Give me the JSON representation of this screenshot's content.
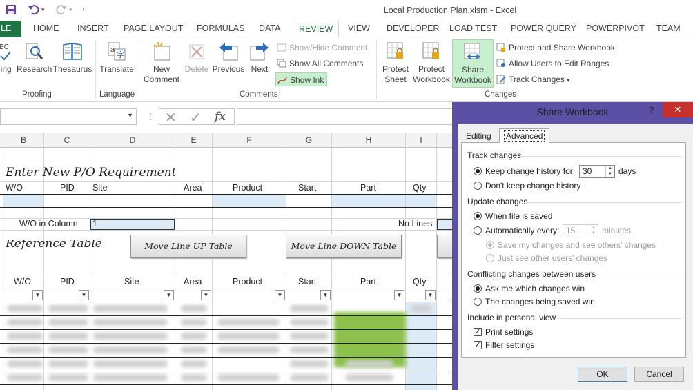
{
  "window": {
    "title": "Local Production Plan.xlsm - Excel"
  },
  "tabs": [
    "FILE",
    "HOME",
    "INSERT",
    "PAGE LAYOUT",
    "FORMULAS",
    "DATA",
    "REVIEW",
    "VIEW",
    "DEVELOPER",
    "LOAD TEST",
    "POWER QUERY",
    "POWERPIVOT",
    "TEAM"
  ],
  "active_tab": "REVIEW",
  "ribbon": {
    "proofing": {
      "spelling": "ling",
      "research": "Research",
      "thesaurus": "Thesaurus",
      "group": "Proofing"
    },
    "language": {
      "translate": "Translate",
      "group": "Language"
    },
    "comments": {
      "new_comment_1": "New",
      "new_comment_2": "Comment",
      "delete": "Delete",
      "previous": "Previous",
      "next": "Next",
      "show_hide": "Show/Hide Comment",
      "show_all": "Show All Comments",
      "show_ink": "Show Ink",
      "group": "Comments"
    },
    "changes": {
      "protect_sheet_1": "Protect",
      "protect_sheet_2": "Sheet",
      "protect_wb_1": "Protect",
      "protect_wb_2": "Workbook",
      "share_wb_1": "Share",
      "share_wb_2": "Workbook",
      "protect_share": "Protect and Share Workbook",
      "allow_users": "Allow Users to Edit Ranges",
      "track_changes": "Track Changes",
      "group": "Changes"
    }
  },
  "formula_bar": {
    "fx": "fx"
  },
  "grid": {
    "columns": [
      "B",
      "C",
      "D",
      "E",
      "F",
      "G",
      "H",
      "I"
    ],
    "heading_new": "Enter New P/O Requirement",
    "heading_ref": "Reference Table",
    "headers": [
      "W/O",
      "PID",
      "Site",
      "Area",
      "Product",
      "Start",
      "Part",
      "Qty"
    ],
    "wo_in_column_label": "W/O in Column",
    "wo_in_column_value": "1",
    "no_lines": "No Lines",
    "move_up": "Move Line UP Table",
    "move_down": "Move Line DOWN Table"
  },
  "dialog": {
    "title": "Share Workbook",
    "help": "?",
    "close": "✕",
    "tabs": [
      "Editing",
      "Advanced"
    ],
    "active_tab": "Advanced",
    "track_changes": {
      "label": "Track changes",
      "keep_history": "Keep change history for:",
      "days_value": "30",
      "days_unit": "days",
      "dont_keep": "Don't keep change history",
      "selected": "keep"
    },
    "update_changes": {
      "label": "Update changes",
      "when_saved": "When file is saved",
      "automatically": "Automatically every:",
      "minutes_value": "15",
      "minutes_unit": "minutes",
      "save_my_changes": "Save my changes and see others' changes",
      "just_see": "Just see other users' changes",
      "selected": "when_saved"
    },
    "conflicting": {
      "label": "Conflicting changes between users",
      "ask_me": "Ask me which changes win",
      "being_saved": "The changes being saved win",
      "selected": "ask"
    },
    "personal_view": {
      "label": "Include in personal view",
      "print_settings": "Print settings",
      "filter_settings": "Filter settings",
      "print_checked": true,
      "filter_checked": true
    },
    "ok": "OK",
    "cancel": "Cancel"
  }
}
